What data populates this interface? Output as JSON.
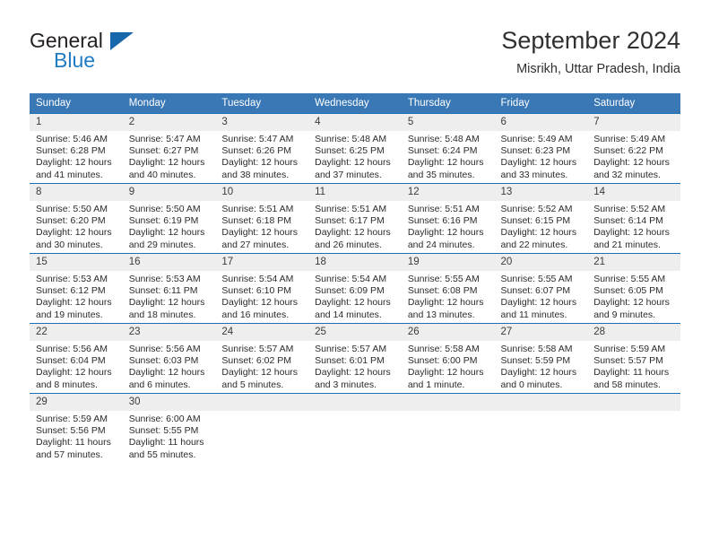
{
  "brand": {
    "name_top": "General",
    "name_bottom": "Blue",
    "accent_color": "#1767ad",
    "text_color": "#231f20"
  },
  "header": {
    "title": "September 2024",
    "subtitle": "Misrikh, Uttar Pradesh, India"
  },
  "calendar": {
    "header_bg": "#3a78b5",
    "header_text_color": "#ffffff",
    "row_border_color": "#1f6fb4",
    "daynum_bg": "#eeeeee",
    "weekdays": [
      "Sunday",
      "Monday",
      "Tuesday",
      "Wednesday",
      "Thursday",
      "Friday",
      "Saturday"
    ],
    "weeks": [
      [
        {
          "day": "1",
          "sunrise": "Sunrise: 5:46 AM",
          "sunset": "Sunset: 6:28 PM",
          "daylight_1": "Daylight: 12 hours",
          "daylight_2": "and 41 minutes."
        },
        {
          "day": "2",
          "sunrise": "Sunrise: 5:47 AM",
          "sunset": "Sunset: 6:27 PM",
          "daylight_1": "Daylight: 12 hours",
          "daylight_2": "and 40 minutes."
        },
        {
          "day": "3",
          "sunrise": "Sunrise: 5:47 AM",
          "sunset": "Sunset: 6:26 PM",
          "daylight_1": "Daylight: 12 hours",
          "daylight_2": "and 38 minutes."
        },
        {
          "day": "4",
          "sunrise": "Sunrise: 5:48 AM",
          "sunset": "Sunset: 6:25 PM",
          "daylight_1": "Daylight: 12 hours",
          "daylight_2": "and 37 minutes."
        },
        {
          "day": "5",
          "sunrise": "Sunrise: 5:48 AM",
          "sunset": "Sunset: 6:24 PM",
          "daylight_1": "Daylight: 12 hours",
          "daylight_2": "and 35 minutes."
        },
        {
          "day": "6",
          "sunrise": "Sunrise: 5:49 AM",
          "sunset": "Sunset: 6:23 PM",
          "daylight_1": "Daylight: 12 hours",
          "daylight_2": "and 33 minutes."
        },
        {
          "day": "7",
          "sunrise": "Sunrise: 5:49 AM",
          "sunset": "Sunset: 6:22 PM",
          "daylight_1": "Daylight: 12 hours",
          "daylight_2": "and 32 minutes."
        }
      ],
      [
        {
          "day": "8",
          "sunrise": "Sunrise: 5:50 AM",
          "sunset": "Sunset: 6:20 PM",
          "daylight_1": "Daylight: 12 hours",
          "daylight_2": "and 30 minutes."
        },
        {
          "day": "9",
          "sunrise": "Sunrise: 5:50 AM",
          "sunset": "Sunset: 6:19 PM",
          "daylight_1": "Daylight: 12 hours",
          "daylight_2": "and 29 minutes."
        },
        {
          "day": "10",
          "sunrise": "Sunrise: 5:51 AM",
          "sunset": "Sunset: 6:18 PM",
          "daylight_1": "Daylight: 12 hours",
          "daylight_2": "and 27 minutes."
        },
        {
          "day": "11",
          "sunrise": "Sunrise: 5:51 AM",
          "sunset": "Sunset: 6:17 PM",
          "daylight_1": "Daylight: 12 hours",
          "daylight_2": "and 26 minutes."
        },
        {
          "day": "12",
          "sunrise": "Sunrise: 5:51 AM",
          "sunset": "Sunset: 6:16 PM",
          "daylight_1": "Daylight: 12 hours",
          "daylight_2": "and 24 minutes."
        },
        {
          "day": "13",
          "sunrise": "Sunrise: 5:52 AM",
          "sunset": "Sunset: 6:15 PM",
          "daylight_1": "Daylight: 12 hours",
          "daylight_2": "and 22 minutes."
        },
        {
          "day": "14",
          "sunrise": "Sunrise: 5:52 AM",
          "sunset": "Sunset: 6:14 PM",
          "daylight_1": "Daylight: 12 hours",
          "daylight_2": "and 21 minutes."
        }
      ],
      [
        {
          "day": "15",
          "sunrise": "Sunrise: 5:53 AM",
          "sunset": "Sunset: 6:12 PM",
          "daylight_1": "Daylight: 12 hours",
          "daylight_2": "and 19 minutes."
        },
        {
          "day": "16",
          "sunrise": "Sunrise: 5:53 AM",
          "sunset": "Sunset: 6:11 PM",
          "daylight_1": "Daylight: 12 hours",
          "daylight_2": "and 18 minutes."
        },
        {
          "day": "17",
          "sunrise": "Sunrise: 5:54 AM",
          "sunset": "Sunset: 6:10 PM",
          "daylight_1": "Daylight: 12 hours",
          "daylight_2": "and 16 minutes."
        },
        {
          "day": "18",
          "sunrise": "Sunrise: 5:54 AM",
          "sunset": "Sunset: 6:09 PM",
          "daylight_1": "Daylight: 12 hours",
          "daylight_2": "and 14 minutes."
        },
        {
          "day": "19",
          "sunrise": "Sunrise: 5:55 AM",
          "sunset": "Sunset: 6:08 PM",
          "daylight_1": "Daylight: 12 hours",
          "daylight_2": "and 13 minutes."
        },
        {
          "day": "20",
          "sunrise": "Sunrise: 5:55 AM",
          "sunset": "Sunset: 6:07 PM",
          "daylight_1": "Daylight: 12 hours",
          "daylight_2": "and 11 minutes."
        },
        {
          "day": "21",
          "sunrise": "Sunrise: 5:55 AM",
          "sunset": "Sunset: 6:05 PM",
          "daylight_1": "Daylight: 12 hours",
          "daylight_2": "and 9 minutes."
        }
      ],
      [
        {
          "day": "22",
          "sunrise": "Sunrise: 5:56 AM",
          "sunset": "Sunset: 6:04 PM",
          "daylight_1": "Daylight: 12 hours",
          "daylight_2": "and 8 minutes."
        },
        {
          "day": "23",
          "sunrise": "Sunrise: 5:56 AM",
          "sunset": "Sunset: 6:03 PM",
          "daylight_1": "Daylight: 12 hours",
          "daylight_2": "and 6 minutes."
        },
        {
          "day": "24",
          "sunrise": "Sunrise: 5:57 AM",
          "sunset": "Sunset: 6:02 PM",
          "daylight_1": "Daylight: 12 hours",
          "daylight_2": "and 5 minutes."
        },
        {
          "day": "25",
          "sunrise": "Sunrise: 5:57 AM",
          "sunset": "Sunset: 6:01 PM",
          "daylight_1": "Daylight: 12 hours",
          "daylight_2": "and 3 minutes."
        },
        {
          "day": "26",
          "sunrise": "Sunrise: 5:58 AM",
          "sunset": "Sunset: 6:00 PM",
          "daylight_1": "Daylight: 12 hours",
          "daylight_2": "and 1 minute."
        },
        {
          "day": "27",
          "sunrise": "Sunrise: 5:58 AM",
          "sunset": "Sunset: 5:59 PM",
          "daylight_1": "Daylight: 12 hours",
          "daylight_2": "and 0 minutes."
        },
        {
          "day": "28",
          "sunrise": "Sunrise: 5:59 AM",
          "sunset": "Sunset: 5:57 PM",
          "daylight_1": "Daylight: 11 hours",
          "daylight_2": "and 58 minutes."
        }
      ],
      [
        {
          "day": "29",
          "sunrise": "Sunrise: 5:59 AM",
          "sunset": "Sunset: 5:56 PM",
          "daylight_1": "Daylight: 11 hours",
          "daylight_2": "and 57 minutes."
        },
        {
          "day": "30",
          "sunrise": "Sunrise: 6:00 AM",
          "sunset": "Sunset: 5:55 PM",
          "daylight_1": "Daylight: 11 hours",
          "daylight_2": "and 55 minutes."
        },
        {
          "day": "",
          "sunrise": "",
          "sunset": "",
          "daylight_1": "",
          "daylight_2": ""
        },
        {
          "day": "",
          "sunrise": "",
          "sunset": "",
          "daylight_1": "",
          "daylight_2": ""
        },
        {
          "day": "",
          "sunrise": "",
          "sunset": "",
          "daylight_1": "",
          "daylight_2": ""
        },
        {
          "day": "",
          "sunrise": "",
          "sunset": "",
          "daylight_1": "",
          "daylight_2": ""
        },
        {
          "day": "",
          "sunrise": "",
          "sunset": "",
          "daylight_1": "",
          "daylight_2": ""
        }
      ]
    ]
  }
}
